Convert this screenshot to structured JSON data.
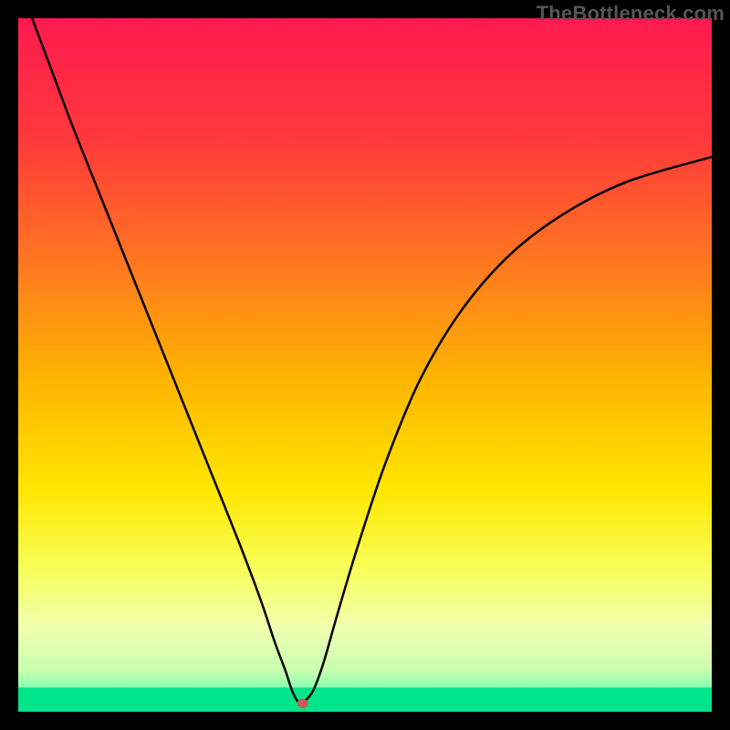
{
  "watermark": "TheBottleneck.com",
  "chart_data": {
    "type": "line",
    "title": "",
    "xlabel": "",
    "ylabel": "",
    "xlim": [
      0,
      100
    ],
    "ylim": [
      0,
      100
    ],
    "grid": false,
    "legend": false,
    "background_gradient": {
      "type": "vertical",
      "stops": [
        {
          "offset": 0.0,
          "color": "#ff1a4f"
        },
        {
          "offset": 0.18,
          "color": "#ff3a3a"
        },
        {
          "offset": 0.36,
          "color": "#ff7a1f"
        },
        {
          "offset": 0.52,
          "color": "#ffb400"
        },
        {
          "offset": 0.68,
          "color": "#ffe600"
        },
        {
          "offset": 0.8,
          "color": "#f7ff5e"
        },
        {
          "offset": 0.88,
          "color": "#f0ffb0"
        },
        {
          "offset": 0.94,
          "color": "#c8ffb0"
        },
        {
          "offset": 0.97,
          "color": "#7dffb0"
        },
        {
          "offset": 1.0,
          "color": "#00e58a"
        }
      ]
    },
    "green_band": {
      "y_from": 0,
      "y_to": 3.5
    },
    "marker": {
      "x": 41,
      "y": 1.2,
      "color": "#c85a5a",
      "r": 6
    },
    "series": [
      {
        "name": "left",
        "x": [
          2,
          5,
          8,
          12,
          16,
          20,
          24,
          28,
          32,
          35,
          37,
          38.5,
          39.5,
          40.3,
          41
        ],
        "y": [
          100,
          92,
          84,
          74,
          64,
          54,
          44,
          34,
          24,
          16,
          10,
          6,
          3,
          1.5,
          1.2
        ]
      },
      {
        "name": "right",
        "x": [
          41,
          42.5,
          44,
          46,
          49,
          53,
          58,
          64,
          71,
          79,
          88,
          100
        ],
        "y": [
          1.2,
          3,
          7,
          14,
          24,
          36,
          48,
          58,
          66,
          72,
          76.5,
          80
        ]
      }
    ],
    "stroke": {
      "color": "#000000",
      "width": 2.5
    }
  }
}
